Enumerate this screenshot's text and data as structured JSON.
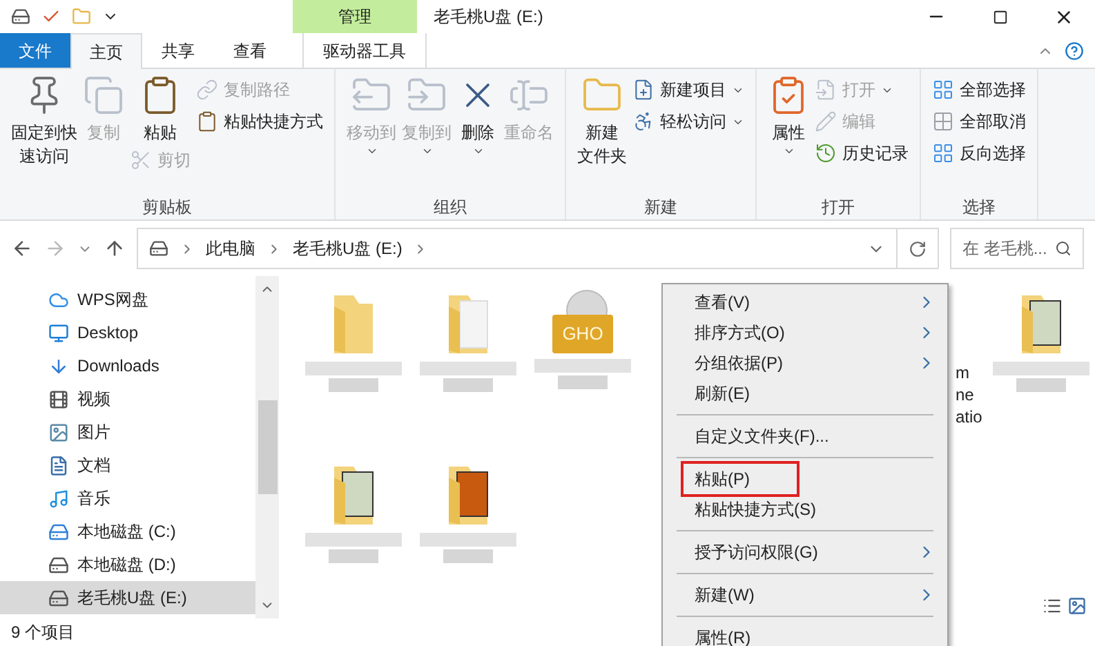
{
  "window": {
    "title": "老毛桃U盘 (E:)",
    "context_group": "管理"
  },
  "tabs": [
    {
      "label": "文件",
      "kind": "file",
      "selected": false
    },
    {
      "label": "主页",
      "kind": "normal",
      "selected": true
    },
    {
      "label": "共享",
      "kind": "normal",
      "selected": false
    },
    {
      "label": "查看",
      "kind": "normal",
      "selected": false
    },
    {
      "label": "驱动器工具",
      "kind": "context",
      "selected": false
    }
  ],
  "ribbon": [
    {
      "name": "剪贴板",
      "items": [
        {
          "kind": "large",
          "lines": [
            "固定到快",
            "速访问"
          ],
          "disabled": false
        },
        {
          "kind": "large",
          "lines": [
            "复制"
          ],
          "disabled": true
        },
        {
          "kind": "large",
          "lines": [
            "粘贴"
          ],
          "disabled": false,
          "extra": [
            {
              "label": "剪切",
              "disabled": true
            }
          ]
        },
        {
          "kind": "stack",
          "items": [
            {
              "label": "复制路径",
              "disabled": true
            },
            {
              "label": "粘贴快捷方式",
              "disabled": false
            }
          ]
        }
      ]
    },
    {
      "name": "组织",
      "items": [
        {
          "kind": "large",
          "lines": [
            "移动到"
          ],
          "disabled": true,
          "dropdown": true
        },
        {
          "kind": "large",
          "lines": [
            "复制到"
          ],
          "disabled": true,
          "dropdown": true
        },
        {
          "kind": "large",
          "lines": [
            "删除"
          ],
          "disabled": false,
          "dropdown": true
        },
        {
          "kind": "large",
          "lines": [
            "重命名"
          ],
          "disabled": true
        }
      ]
    },
    {
      "name": "新建",
      "items": [
        {
          "kind": "large",
          "lines": [
            "新建",
            "文件夹"
          ],
          "disabled": false
        },
        {
          "kind": "stack",
          "items": [
            {
              "label": "新建项目",
              "disabled": false,
              "dropdown": true
            },
            {
              "label": "轻松访问",
              "disabled": false,
              "dropdown": true
            }
          ]
        }
      ]
    },
    {
      "name": "打开",
      "items": [
        {
          "kind": "large",
          "lines": [
            "属性"
          ],
          "disabled": false,
          "dropdown": true
        },
        {
          "kind": "stack",
          "items": [
            {
              "label": "打开",
              "disabled": true,
              "dropdown": true
            },
            {
              "label": "编辑",
              "disabled": true
            },
            {
              "label": "历史记录",
              "disabled": false
            }
          ]
        }
      ]
    },
    {
      "name": "选择",
      "items": [
        {
          "kind": "stack",
          "items": [
            {
              "label": "全部选择",
              "disabled": false
            },
            {
              "label": "全部取消",
              "disabled": false
            },
            {
              "label": "反向选择",
              "disabled": false
            }
          ]
        }
      ]
    }
  ],
  "address": {
    "crumbs": [
      "此电脑",
      "老毛桃U盘 (E:)"
    ]
  },
  "search": {
    "placeholder": "在 老毛桃..."
  },
  "nav": [
    {
      "label": "WPS网盘",
      "kind": "cloud",
      "selected": false
    },
    {
      "label": "Desktop",
      "kind": "desktop",
      "selected": false
    },
    {
      "label": "Downloads",
      "kind": "download",
      "selected": false
    },
    {
      "label": "视频",
      "kind": "video",
      "selected": false
    },
    {
      "label": "图片",
      "kind": "picture",
      "selected": false
    },
    {
      "label": "文档",
      "kind": "document",
      "selected": false
    },
    {
      "label": "音乐",
      "kind": "music",
      "selected": false
    },
    {
      "label": "本地磁盘 (C:)",
      "kind": "system-drive",
      "selected": false
    },
    {
      "label": "本地磁盘 (D:)",
      "kind": "drive",
      "selected": false
    },
    {
      "label": "老毛桃U盘 (E:)",
      "kind": "drive",
      "selected": true
    }
  ],
  "files": [
    {
      "kind": "folder"
    },
    {
      "kind": "folder-docs"
    },
    {
      "kind": "gho",
      "badge": "GHO"
    },
    {
      "kind": "label-only",
      "label_lines": [
        "m",
        "ne",
        "atio"
      ]
    },
    {
      "kind": "folder-photo"
    },
    {
      "kind": "folder-photo"
    },
    {
      "kind": "folder-sunset"
    }
  ],
  "context_menu": [
    {
      "kind": "item",
      "label": "查看(V)",
      "submenu": true,
      "annotated": false
    },
    {
      "kind": "item",
      "label": "排序方式(O)",
      "submenu": true,
      "annotated": false
    },
    {
      "kind": "item",
      "label": "分组依据(P)",
      "submenu": true,
      "annotated": false
    },
    {
      "kind": "item",
      "label": "刷新(E)",
      "submenu": false,
      "annotated": false
    },
    {
      "kind": "separator"
    },
    {
      "kind": "item",
      "label": "自定义文件夹(F)...",
      "submenu": false,
      "annotated": false
    },
    {
      "kind": "separator"
    },
    {
      "kind": "item",
      "label": "粘贴(P)",
      "submenu": false,
      "annotated": true
    },
    {
      "kind": "item",
      "label": "粘贴快捷方式(S)",
      "submenu": false,
      "annotated": false
    },
    {
      "kind": "separator"
    },
    {
      "kind": "item",
      "label": "授予访问权限(G)",
      "submenu": true,
      "annotated": false
    },
    {
      "kind": "separator"
    },
    {
      "kind": "item",
      "label": "新建(W)",
      "submenu": true,
      "annotated": false
    },
    {
      "kind": "separator"
    },
    {
      "kind": "item",
      "label": "属性(R)",
      "submenu": false,
      "annotated": false
    }
  ],
  "status_bar": {
    "count": "9 个项目"
  }
}
